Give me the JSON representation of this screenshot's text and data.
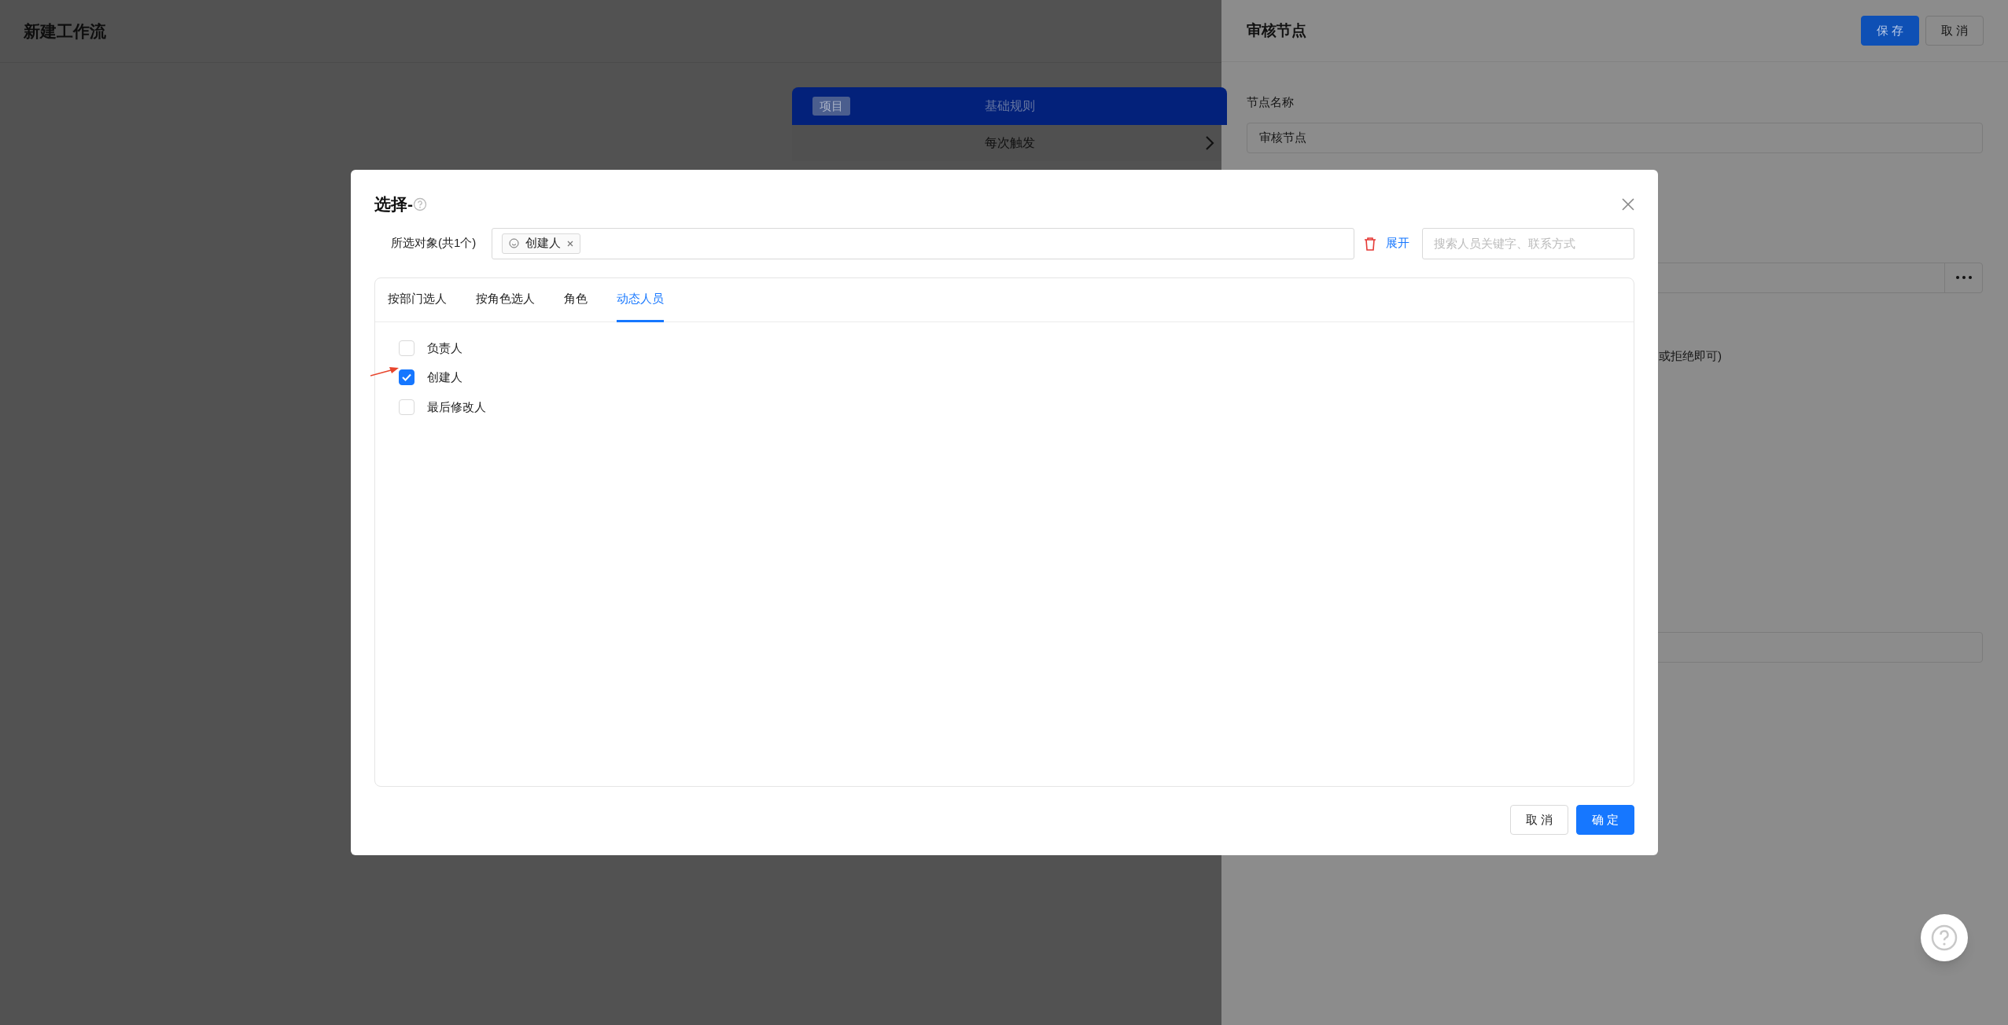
{
  "page": {
    "title": "新建工作流"
  },
  "workflow_card": {
    "badge": "项目",
    "title": "基础规则",
    "row": "每次触发"
  },
  "drawer": {
    "title": "审核节点",
    "buttons": [
      {
        "label": "保 存",
        "kind": "primary"
      },
      {
        "label": "取 消",
        "kind": "default"
      }
    ],
    "node_name": {
      "label": "节点名称",
      "value": "审核节点"
    },
    "partial_text": "或拒绝即可)"
  },
  "dialog": {
    "title": "选择-",
    "selected_label": "所选对象(共1个)",
    "selected_tags": [
      {
        "label": "创建人"
      }
    ],
    "expand_link": "展开",
    "search": {
      "placeholder": "搜索人员关键字、联系方式"
    },
    "tabs": [
      {
        "label": "按部门选人",
        "selected": false
      },
      {
        "label": "按角色选人",
        "selected": false
      },
      {
        "label": "角色",
        "selected": false
      },
      {
        "label": "动态人员",
        "selected": true
      }
    ],
    "options": [
      {
        "label": "负责人",
        "checked": false
      },
      {
        "label": "创建人",
        "checked": true
      },
      {
        "label": "最后修改人",
        "checked": false
      }
    ],
    "buttons": [
      {
        "label": "取 消",
        "kind": "default"
      },
      {
        "label": "确 定",
        "kind": "primary"
      }
    ]
  }
}
